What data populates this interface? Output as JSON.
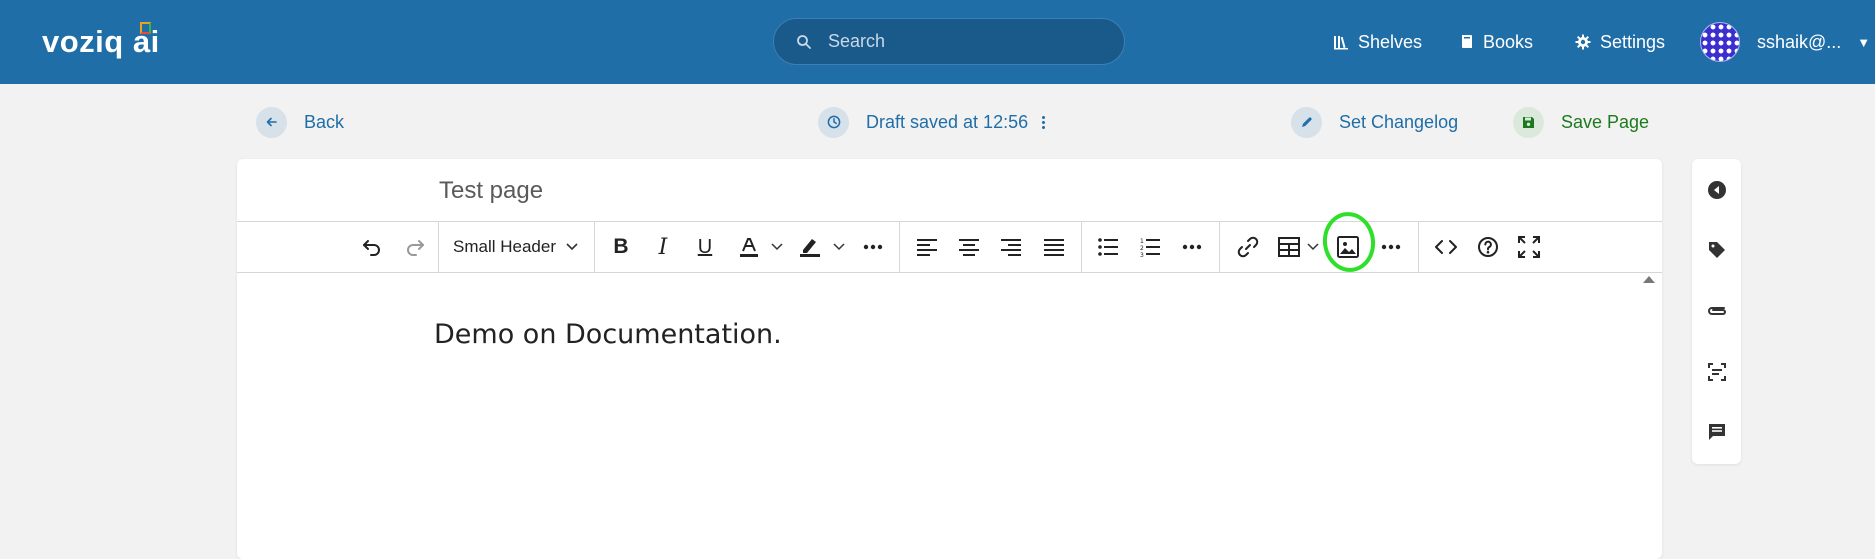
{
  "header": {
    "logo": "voziq ai",
    "search_placeholder": "Search",
    "nav": [
      {
        "label": "Shelves",
        "icon": "shelves-icon"
      },
      {
        "label": "Books",
        "icon": "book-icon"
      },
      {
        "label": "Settings",
        "icon": "gear-icon"
      }
    ],
    "user": "sshaik@..."
  },
  "actions": {
    "back": "Back",
    "draft_status": "Draft saved at 12:56",
    "changelog": "Set Changelog",
    "save": "Save Page"
  },
  "editor": {
    "page_title": "Test page",
    "block_style": "Small Header",
    "content": "Demo on Documentation."
  },
  "colors": {
    "header_bg": "#206ea7",
    "accent": "#206ea7",
    "save_green": "#1c7a1c",
    "annotation_ring": "#2ee02a"
  },
  "sidebar_tools": [
    "collapse-icon",
    "tag-icon",
    "attachment-icon",
    "template-icon",
    "comment-icon"
  ]
}
